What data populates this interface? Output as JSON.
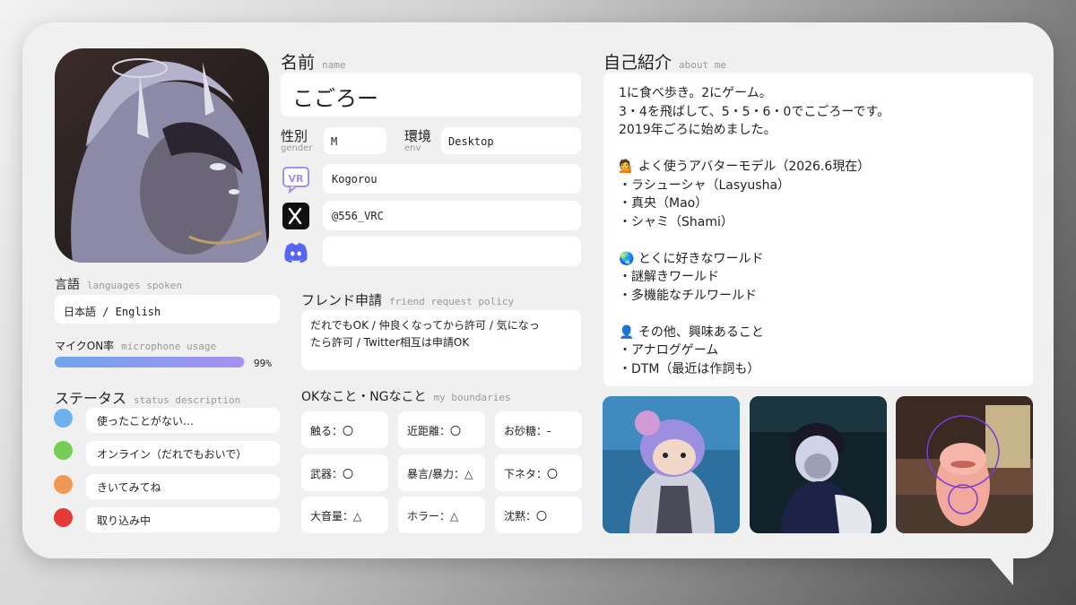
{
  "name": {
    "label": "名前",
    "sub": "name",
    "value": "こごろー"
  },
  "gender": {
    "label": "性別",
    "sub": "gender",
    "value": "M"
  },
  "env": {
    "label": "環境",
    "sub": "env",
    "value": "Desktop"
  },
  "accounts": {
    "vrchat": "Kogorou",
    "x": "@556_VRC",
    "discord": ""
  },
  "languages": {
    "label": "言語",
    "sub": "languages spoken",
    "value": "日本語 / English"
  },
  "mic": {
    "label": "マイクON率",
    "sub": "microphone usage",
    "percent": 99,
    "text": "99%"
  },
  "status": {
    "label": "ステータス",
    "sub": "status description",
    "items": [
      {
        "color": "#6cb0ee",
        "text": "使ったことがない…"
      },
      {
        "color": "#77cc55",
        "text": "オンライン（だれでもおいで）"
      },
      {
        "color": "#ef9955",
        "text": "きいてみてね"
      },
      {
        "color": "#e53a35",
        "text": "取り込み中"
      }
    ]
  },
  "friend": {
    "label": "フレンド申請",
    "sub": "friend request policy",
    "line1": "だれでもOK / 仲良くなってから許可 / 気になっ",
    "line2": "たら許可 / Twitter相互は申請OK"
  },
  "boundaries": {
    "label": "OKなこと・NGなこと",
    "sub": "my boundaries",
    "items": [
      "触る：〇",
      "近距離：〇",
      "お砂糖：-",
      "武器：〇",
      "暴言/暴力：△",
      "下ネタ：〇",
      "大音量：△",
      "ホラー：△",
      "沈黙：〇"
    ]
  },
  "about": {
    "label": "自己紹介",
    "sub": "about me",
    "lines": [
      "1に食べ歩き。2にゲーム。",
      "3・4を飛ばして、5・5・6・0でこごろーです。",
      "2019年ごろに始めました。",
      "",
      "💁 よく使うアバターモデル（2026.6現在）",
      "・ラシューシャ（Lasyusha）",
      "・真央（Mao）",
      "・シャミ（Shami）",
      "",
      "🌏 とくに好きなワールド",
      "・謎解きワールド",
      "・多機能なチルワールド",
      "",
      "👤 その他、興味あること",
      "・アナログゲーム",
      "・DTM（最近は作詞も）"
    ]
  },
  "colors": {
    "card": "#f0f0f0",
    "box": "#ffffff",
    "mic_start": "#6ea6ee",
    "mic_end": "#a98ff0",
    "vr_icon": "#a58ef2",
    "discord": "#5865F2"
  }
}
